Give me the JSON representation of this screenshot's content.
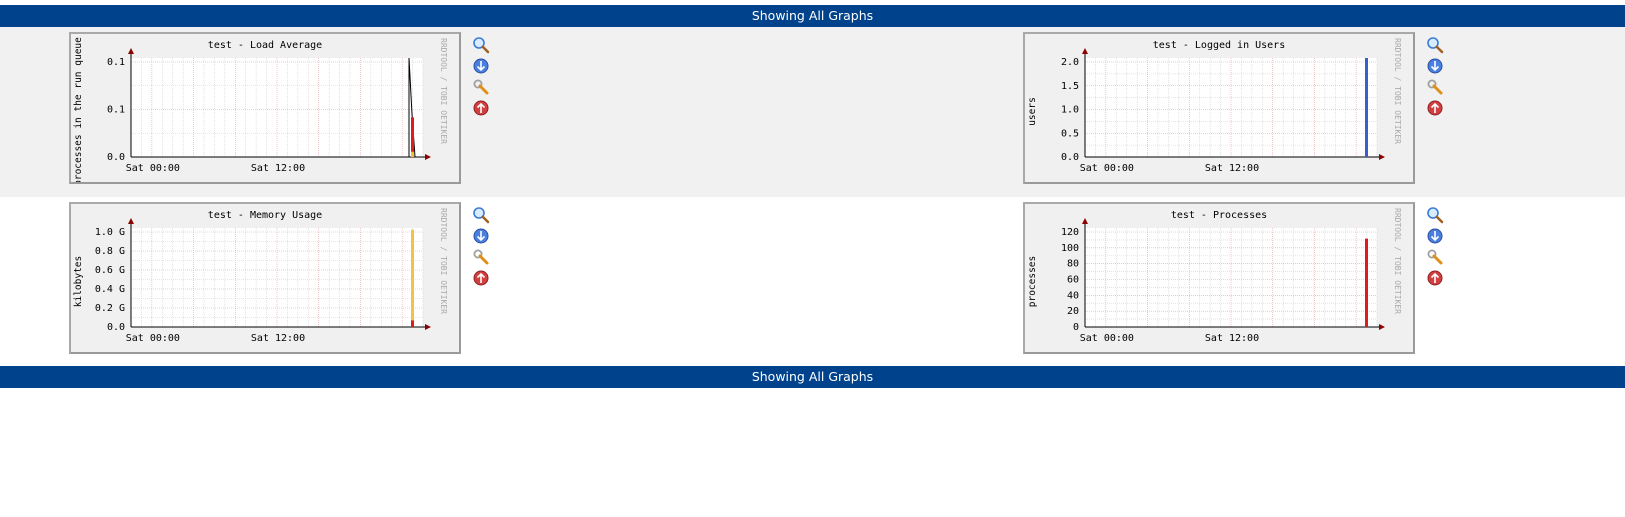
{
  "header": {
    "title": "Showing All Graphs"
  },
  "footer": {
    "title": "Showing All Graphs"
  },
  "watermark": "RRDTOOL / TOBI OETIKER",
  "icon_names": [
    "zoom-icon",
    "export-icon",
    "settings-icon",
    "move-up-icon"
  ],
  "colors": {
    "banner": "#00438c",
    "grid_major": "#e8a0a0",
    "grid_minor": "#d0d0d0",
    "axis": "#000000",
    "arrow": "#8b0000",
    "row_shaded": "#f1f1f1"
  },
  "chart_data": [
    {
      "type": "area",
      "title": "test - Load Average",
      "ylabel": "processes in the run queue",
      "x_ticks": [
        "Sat 00:00",
        "Sat 12:00"
      ],
      "y_ticks": [
        "0.1",
        "0.1",
        "0.0"
      ],
      "ylim": [
        0,
        0.15
      ],
      "series": [
        {
          "color": "#000000",
          "style": "line",
          "values": [
            0,
            0,
            0,
            0,
            0,
            0.15,
            0.065,
            0
          ]
        },
        {
          "color": "#e01b1b",
          "style": "bar",
          "values": [
            0.06
          ]
        },
        {
          "color": "#f0c030",
          "style": "bar",
          "values": [
            0.008
          ]
        }
      ]
    },
    {
      "type": "area",
      "title": "test - Logged in Users",
      "ylabel": "users",
      "x_ticks": [
        "Sat 00:00",
        "Sat 12:00"
      ],
      "y_ticks": [
        "2.0",
        "1.5",
        "1.0",
        "0.5",
        "0.0"
      ],
      "ylim": [
        0,
        2.0
      ],
      "series": [
        {
          "color": "#3a5fcd",
          "style": "bar",
          "values": [
            2.0
          ]
        }
      ]
    },
    {
      "type": "area",
      "title": "test - Memory Usage",
      "ylabel": "kilobytes",
      "x_ticks": [
        "Sat 00:00",
        "Sat 12:00"
      ],
      "y_ticks": [
        "1.0 G",
        "0.8 G",
        "0.6 G",
        "0.4 G",
        "0.2 G",
        "0.0"
      ],
      "ylim": [
        0,
        1.2
      ],
      "series": [
        {
          "color": "#f8c040",
          "style": "bar",
          "values": [
            1.18
          ]
        },
        {
          "color": "#e01b1b",
          "style": "bar",
          "values": [
            0.08
          ]
        }
      ]
    },
    {
      "type": "area",
      "title": "test - Processes",
      "ylabel": "processes",
      "x_ticks": [
        "Sat 00:00",
        "Sat 12:00"
      ],
      "y_ticks": [
        "120",
        "100",
        "80",
        "60",
        "40",
        "20",
        "0"
      ],
      "ylim": [
        0,
        140
      ],
      "series": [
        {
          "color": "#e01b1b",
          "style": "bar",
          "values": [
            125
          ]
        }
      ]
    }
  ]
}
